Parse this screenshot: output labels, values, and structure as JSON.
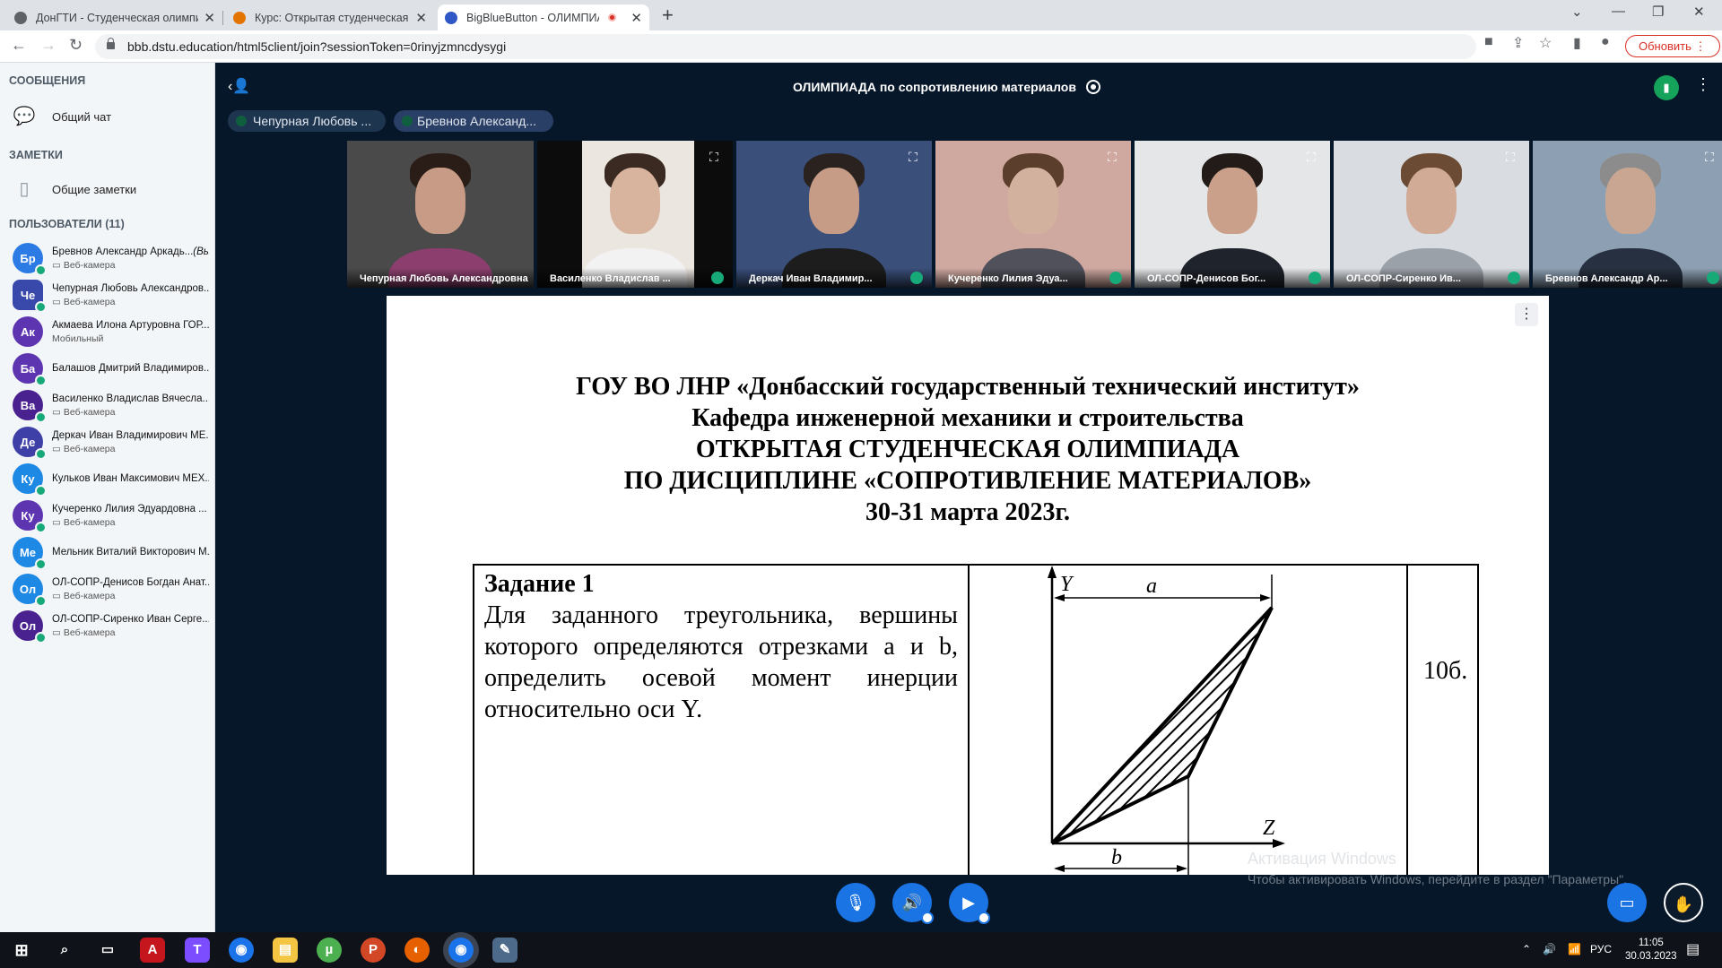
{
  "browser": {
    "tabs": [
      {
        "title": "ДонГТИ - Студенческая олимпи",
        "favicon_color": "#5f6368"
      },
      {
        "title": "Курс: Открытая студенческая ол",
        "favicon_color": "#e37400"
      },
      {
        "title": "BigBlueButton - ОЛИМПИАД",
        "favicon_color": "#2f58c6"
      }
    ],
    "url": "bbb.dstu.education/html5client/join?sessionToken=0rinyjzmncdysygi",
    "update_button": "Обновить"
  },
  "sidebar": {
    "messages_title": "СООБЩЕНИЯ",
    "public_chat": "Общий чат",
    "notes_title": "ЗАМЕТКИ",
    "shared_notes": "Общие заметки",
    "users_title": "ПОЛЬЗОВАТЕЛИ (11)",
    "users": [
      {
        "initials": "Бр",
        "name": "Бревнов Александр Аркадь...",
        "you": "(Вы)",
        "status": "Веб-камера",
        "color": "#2c7be5",
        "shape": "round"
      },
      {
        "initials": "Че",
        "name": "Чепурная Любовь Александров...",
        "you": "",
        "status": "Веб-камера",
        "color": "#3949ab",
        "shape": "square"
      },
      {
        "initials": "Ак",
        "name": "Акмаева Илона Артуровна ГОР...",
        "you": "",
        "status": "Мобильный",
        "color": "#5e35b1",
        "shape": "round"
      },
      {
        "initials": "Ба",
        "name": "Балашов Дмитрий Владимиров...",
        "you": "",
        "status": "",
        "color": "#5e35b1",
        "shape": "round"
      },
      {
        "initials": "Ва",
        "name": "Василенко Владислав Вячесла...",
        "you": "",
        "status": "Веб-камера",
        "color": "#4a2290",
        "shape": "round"
      },
      {
        "initials": "Де",
        "name": "Деркач Иван Владимирович МЕ...",
        "you": "",
        "status": "Веб-камера",
        "color": "#3f3fa8",
        "shape": "round"
      },
      {
        "initials": "Ку",
        "name": "Кульков Иван Максимович МЕХ...",
        "you": "",
        "status": "",
        "color": "#1e88e5",
        "shape": "round"
      },
      {
        "initials": "Ку",
        "name": "Кучеренко Лилия Эдуардовна ...",
        "you": "",
        "status": "Веб-камера",
        "color": "#5e35b1",
        "shape": "round"
      },
      {
        "initials": "Ме",
        "name": "Мельник Виталий Викторович М...",
        "you": "",
        "status": "",
        "color": "#1e88e5",
        "shape": "round"
      },
      {
        "initials": "Ол",
        "name": "ОЛ-СОПР-Денисов Богдан Анат...",
        "you": "",
        "status": "Веб-камера",
        "color": "#1e88e5",
        "shape": "round"
      },
      {
        "initials": "Ол",
        "name": "ОЛ-СОПР-Сиренко Иван Серге...",
        "you": "",
        "status": "Веб-камера",
        "color": "#4a2290",
        "shape": "round"
      }
    ]
  },
  "main": {
    "meeting_title": "ОЛИМПИАДА по сопротивлению материалов",
    "talkers": [
      "Чепурная Любовь ...",
      "Бревнов Александ..."
    ],
    "videos": [
      {
        "name": "Чепурная Любовь Александровна",
        "bg": "#4a4a4a",
        "face": "#c79b85",
        "hair": "#2a1c17",
        "shirt": "#8c3f6f"
      },
      {
        "name": "Василенко Владислав ...",
        "bg": "#0c0c0c",
        "face": "#d8b39d",
        "hair": "#3b2a22",
        "shirt": "#f2f2f2"
      },
      {
        "name": "Деркач Иван Владимир...",
        "bg": "#3a4f7a",
        "face": "#c69c86",
        "hair": "#2a221f",
        "shirt": "#1d1d1d"
      },
      {
        "name": "Кучеренко Лилия Эдуа...",
        "bg": "#cfa8a0",
        "face": "#d3b19f",
        "hair": "#5b3e2c",
        "shirt": "#50515a"
      },
      {
        "name": "ОЛ-СОПР-Денисов Бог...",
        "bg": "#e4e6e8",
        "face": "#caa08b",
        "hair": "#221b18",
        "shirt": "#1f232b"
      },
      {
        "name": "ОЛ-СОПР-Сиренко Ив...",
        "bg": "#d9dde2",
        "face": "#d2ab96",
        "hair": "#6b4b33",
        "shirt": "#9ba1a8"
      },
      {
        "name": "Бревнов Александр Ар...",
        "bg": "#8da0b3",
        "face": "#c9a692",
        "hair": "#8c8c8c",
        "shirt": "#263040"
      }
    ],
    "slide": {
      "heading_lines": [
        "ГОУ ВО ЛНР «Донбасский государственный технический институт»",
        "Кафедра инженерной механики и строительства",
        "ОТКРЫТАЯ СТУДЕНЧЕСКАЯ ОЛИМПИАДА",
        "ПО ДИСЦИПЛИНЕ «СОПРОТИВЛЕНИЕ МАТЕРИАЛОВ»",
        "30-31 марта 2023г."
      ],
      "task_title": "Задание 1",
      "task_text": "Для заданного треугольника, вершины которого определяются отрезками a и b, определить осевой момент инерции относительно оси Y.",
      "score": "10б.",
      "diagram": {
        "axis_y": "Y",
        "axis_z": "Z",
        "label_a": "a",
        "label_b": "b"
      }
    },
    "activation_title": "Активация Windows",
    "activation_text": "Чтобы активировать Windows, перейдите в раздел \"Параметры\"."
  },
  "taskbar": {
    "lang": "РУС",
    "time": "11:05",
    "date": "30.03.2023"
  }
}
